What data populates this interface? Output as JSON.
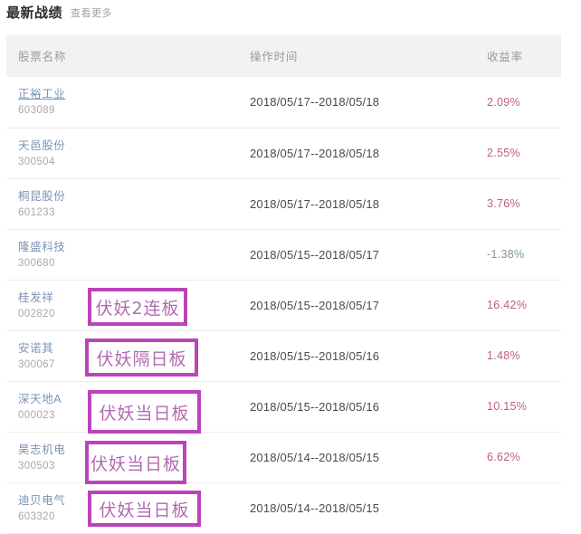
{
  "section": {
    "title": "最新战绩",
    "more_label": "查看更多"
  },
  "table": {
    "columns": [
      {
        "key": "name",
        "label": "股票名称"
      },
      {
        "key": "time",
        "label": "操作时间"
      },
      {
        "key": "profit",
        "label": "收益率"
      }
    ],
    "rows": [
      {
        "name": "正裕工业",
        "code": "603089",
        "time": "2018/05/17--2018/05/18",
        "profit": "2.09%",
        "sign": "pos",
        "annotation": ""
      },
      {
        "name": "天邑股份",
        "code": "300504",
        "time": "2018/05/17--2018/05/18",
        "profit": "2.55%",
        "sign": "pos",
        "annotation": ""
      },
      {
        "name": "桐昆股份",
        "code": "601233",
        "time": "2018/05/17--2018/05/18",
        "profit": "3.76%",
        "sign": "pos",
        "annotation": ""
      },
      {
        "name": "隆盛科技",
        "code": "300680",
        "time": "2018/05/15--2018/05/17",
        "profit": "-1.38%",
        "sign": "neg",
        "annotation": ""
      },
      {
        "name": "桂发祥",
        "code": "002820",
        "time": "2018/05/15--2018/05/17",
        "profit": "16.42%",
        "sign": "pos",
        "annotation": "伏妖2连板"
      },
      {
        "name": "安诺其",
        "code": "300067",
        "time": "2018/05/15--2018/05/16",
        "profit": "1.48%",
        "sign": "pos",
        "annotation": "伏妖隔日板"
      },
      {
        "name": "深天地A",
        "code": "000023",
        "time": "2018/05/15--2018/05/16",
        "profit": "10.15%",
        "sign": "pos",
        "annotation": "伏妖当日板"
      },
      {
        "name": "昊志机电",
        "code": "300503",
        "time": "2018/05/14--2018/05/15",
        "profit": "6.62%",
        "sign": "pos",
        "annotation": "伏妖当日板"
      },
      {
        "name": "迪贝电气",
        "code": "603320",
        "time": "2018/05/14--2018/05/15",
        "profit": "",
        "sign": "pos",
        "annotation": "伏妖当日板"
      }
    ]
  },
  "annotations": [
    {
      "id": "anno-1",
      "text": "伏妖2连板"
    },
    {
      "id": "anno-2",
      "text": "伏妖隔日板"
    },
    {
      "id": "anno-3",
      "text": "伏妖当日板"
    },
    {
      "id": "anno-4",
      "text": "伏妖当日板"
    },
    {
      "id": "anno-5",
      "text": "伏妖当日板"
    }
  ],
  "colors": {
    "positive": "#c06077",
    "negative": "#7d9b7d",
    "link": "#7b94b4",
    "annotation_border": "#bb44bb",
    "annotation_text": "#b26ab2",
    "header_bg": "#f2f2f2"
  }
}
